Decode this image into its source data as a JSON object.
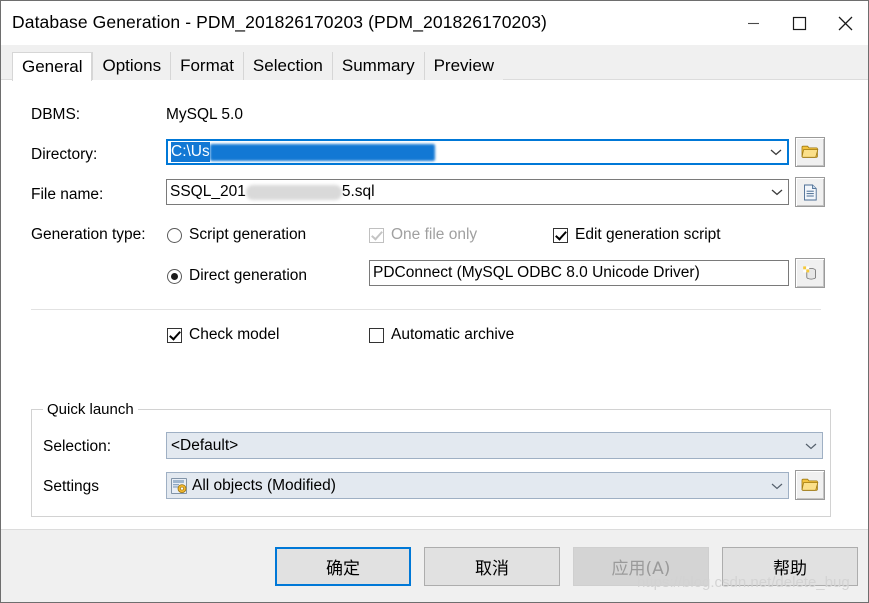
{
  "window": {
    "title": "Database Generation - PDM_201826170203 (PDM_201826170203)",
    "minimize_label": "minimize",
    "maximize_label": "maximize",
    "close_label": "close"
  },
  "tabs": [
    {
      "label": "General",
      "active": true
    },
    {
      "label": "Options",
      "active": false
    },
    {
      "label": "Format",
      "active": false
    },
    {
      "label": "Selection",
      "active": false
    },
    {
      "label": "Summary",
      "active": false
    },
    {
      "label": "Preview",
      "active": false
    }
  ],
  "general": {
    "dbms_label": "DBMS:",
    "dbms_value": "MySQL 5.0",
    "directory_label": "Directory:",
    "directory_value_visible": "C:\\Us",
    "directory_redacted": true,
    "directory_browse_icon": "folder-icon",
    "filename_label": "File name:",
    "filename_prefix": "SSQL_201",
    "filename_suffix": "5.sql",
    "filename_redacted": true,
    "filename_browse_icon": "document-icon",
    "generation_type_label": "Generation type:",
    "script_generation_label": "Script generation",
    "script_generation_selected": false,
    "direct_generation_label": "Direct generation",
    "direct_generation_selected": true,
    "one_file_only_label": "One file only",
    "one_file_only_checked": true,
    "one_file_only_disabled": true,
    "edit_generation_script_label": "Edit generation script",
    "edit_generation_script_checked": true,
    "connection_value": "PDConnect (MySQL ODBC 8.0 Unicode Driver)",
    "connection_button_icon": "database-icon",
    "check_model_label": "Check model",
    "check_model_checked": true,
    "automatic_archive_label": "Automatic archive",
    "automatic_archive_checked": false
  },
  "quick_launch": {
    "group_title": "Quick launch",
    "selection_label": "Selection:",
    "selection_value": "<Default>",
    "settings_label": "Settings",
    "settings_value": "All objects (Modified)",
    "settings_item_icon": "settings-gear-icon",
    "settings_browse_icon": "folder-icon"
  },
  "footer": {
    "ok_label": "确定",
    "cancel_label": "取消",
    "apply_label": "应用(A)",
    "apply_disabled": true,
    "help_label": "帮助"
  },
  "watermark": "https://blog.csdn.net/delete_bug",
  "colors": {
    "accent": "#0078d7",
    "selection": "#1278d4",
    "dialog_bg": "#ffffff",
    "footer_bg": "#f0f0f0",
    "combo_bg": "#e3e9f0"
  }
}
